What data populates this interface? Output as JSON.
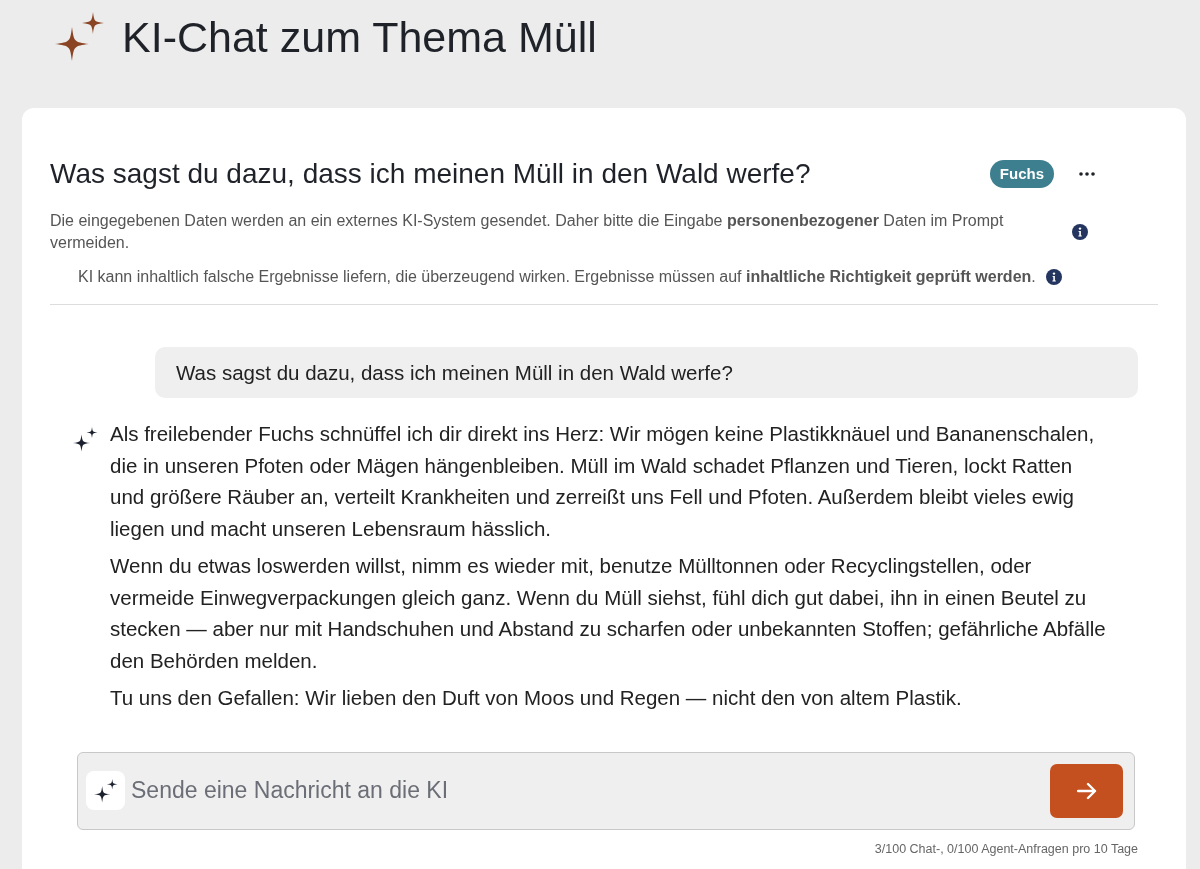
{
  "header": {
    "title": "KI-Chat zum Thema Müll"
  },
  "chat": {
    "title": "Was sagst du dazu, dass ich meinen Müll in den Wald werfe?",
    "persona_badge": "Fuchs",
    "notices": [
      "Die eingegebenen Daten werden an ein externes KI-System gesendet. Daher bitte die Eingabe **personenbezogener** Daten im Prompt vermeiden.",
      "KI kann inhaltlich falsche Ergebnisse liefern, die überzeugend wirken. Ergebnisse müssen auf **inhaltliche Richtigkeit geprüft werden**."
    ],
    "messages": [
      {
        "kind": "user",
        "paragraphs": [
          "Was sagst du dazu, dass ich meinen Müll in den Wald werfe?"
        ]
      },
      {
        "kind": "assistant",
        "paragraphs": [
          "Als freilebender Fuchs schnüffel ich dir direkt ins Herz: Wir mögen keine Plastikknäuel und Bananenschalen, die in unseren Pfoten oder Mägen hängenbleiben. Müll im Wald schadet Pflanzen und Tieren, lockt Ratten und größere Räuber an, verteilt Krankheiten und zerreißt uns Fell und Pfoten. Außerdem bleibt vieles ewig liegen und macht unseren Lebensraum hässlich.",
          "Wenn du etwas loswerden willst, nimm es wieder mit, benutze Mülltonnen oder Recyclingstellen, oder vermeide Einwegverpackungen gleich ganz. Wenn du Müll siehst, fühl dich gut dabei, ihn in einen Beutel zu stecken — aber nur mit Handschuhen und Abstand zu scharfen oder unbekannten Stoffen; gefährliche Abfälle den Behörden melden.",
          "Tu uns den Gefallen: Wir lieben den Duft von Moos und Regen — nicht den von altem Plastik."
        ]
      }
    ],
    "composer": {
      "placeholder": "Sende eine Nachricht an die KI"
    },
    "usage": "3/100 Chat-, 0/100 Agent-Anfragen pro 10 Tage"
  }
}
